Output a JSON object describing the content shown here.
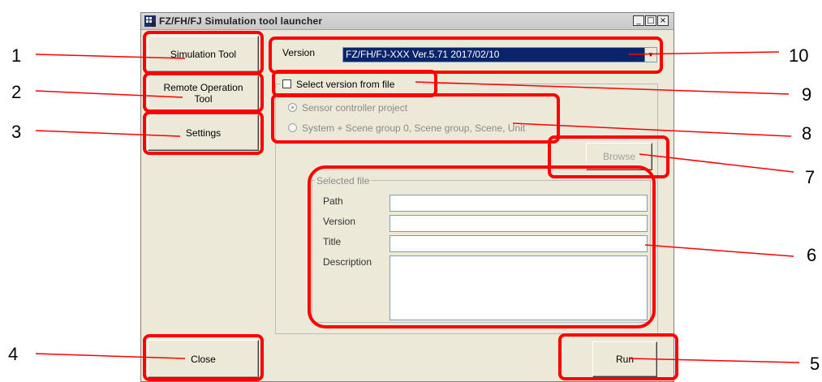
{
  "window": {
    "title": "FZ/FH/FJ Simulation tool launcher",
    "min": "_",
    "max": "□",
    "close": "×"
  },
  "sidebar": {
    "simulation_tool": "Simulation Tool",
    "remote_operation_tool": "Remote Operation Tool",
    "settings": "Settings",
    "close": "Close"
  },
  "version": {
    "label": "Version",
    "selected": "FZ/FH/FJ-XXX Ver.5.71 2017/02/10"
  },
  "select_from_file": {
    "label": "Select version from file",
    "checked": false
  },
  "file_type": {
    "options": [
      "Sensor controller project",
      "System + Scene group 0, Scene group, Scene, Unit"
    ],
    "selected_index": 0
  },
  "browse_button": "Browse",
  "selected_file": {
    "legend": "Selected file",
    "path_label": "Path",
    "version_label": "Version",
    "title_label": "Title",
    "description_label": "Description",
    "path_value": "",
    "version_value": "",
    "title_value": "",
    "description_value": ""
  },
  "run_button": "Run",
  "callouts": [
    "1",
    "2",
    "3",
    "4",
    "5",
    "6",
    "7",
    "8",
    "9",
    "10"
  ],
  "colors": {
    "annotation": "#ff0000",
    "selection_bg": "#0a246a"
  }
}
